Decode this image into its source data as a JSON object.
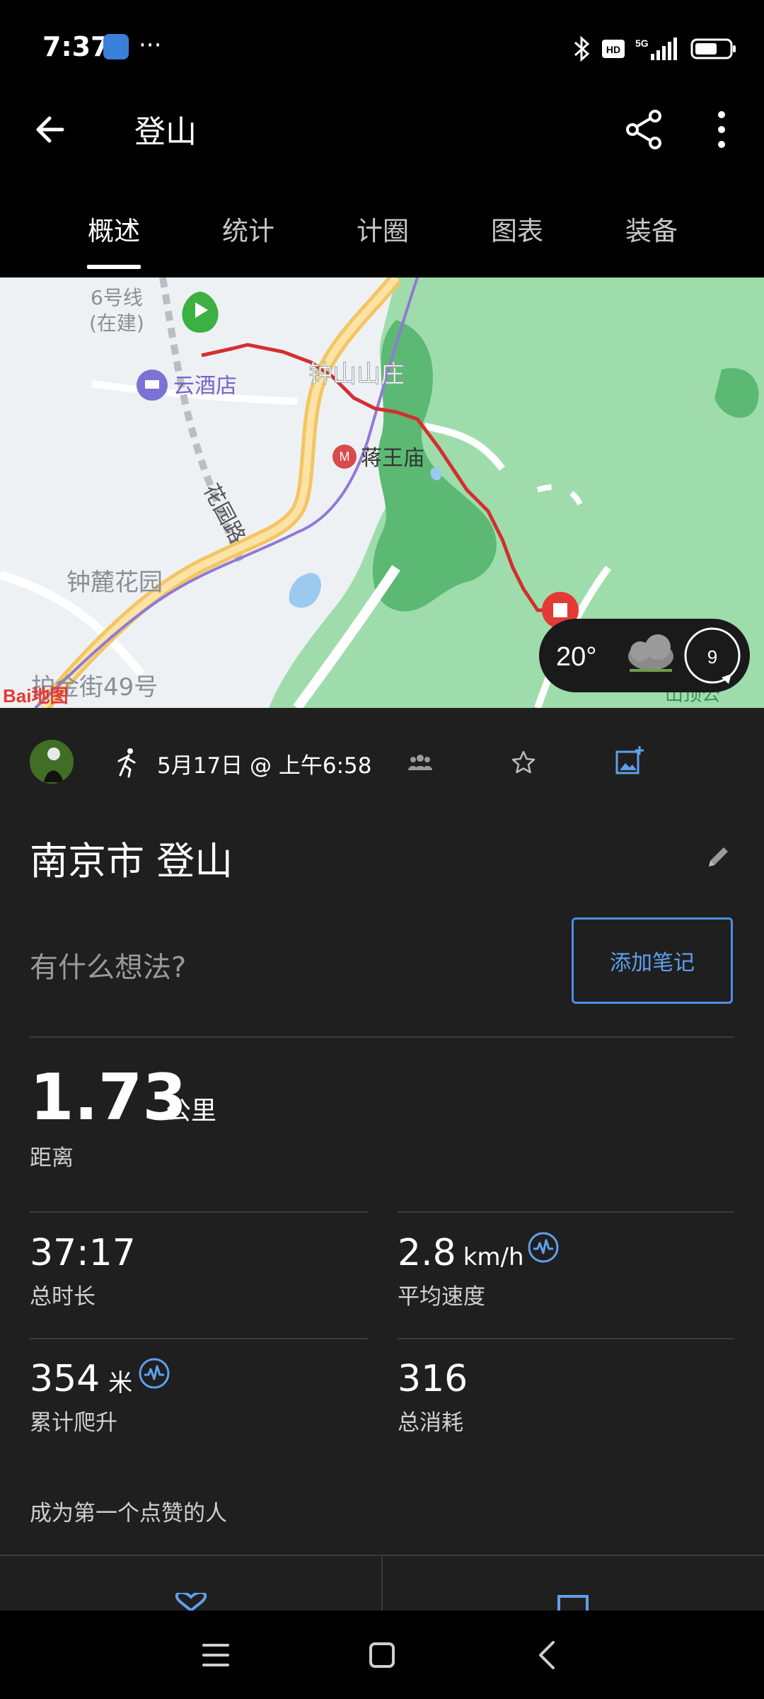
{
  "status_bar": {
    "time": "7:37",
    "more": "···",
    "hd_badge": "HD",
    "network": "5G"
  },
  "app_bar": {
    "title": "登山"
  },
  "tabs": [
    {
      "label": "概述",
      "active": true
    },
    {
      "label": "统计",
      "active": false
    },
    {
      "label": "计圈",
      "active": false
    },
    {
      "label": "图表",
      "active": false
    },
    {
      "label": "装备",
      "active": false
    }
  ],
  "map": {
    "labels": {
      "line6": "6号线",
      "under_construction": "(在建)",
      "hotel": "云酒店",
      "zhongshan": "钟山山庄",
      "jiangwang": "蒋王庙",
      "huayuan": "花园路",
      "zhonglu": "钟麓花园",
      "street": "护金街49号",
      "park": "山顶公",
      "baidu": "Bai地图"
    },
    "weather": {
      "temperature": "20°",
      "wind": "9"
    },
    "colors": {
      "route": "#d32f2f",
      "park_green": "#9fdcac",
      "forest_green": "#5cb974",
      "start_marker": "#3cb043",
      "end_marker": "#e53935"
    }
  },
  "activity": {
    "date": "5月17日 @ 上午6:58",
    "title": "南京市 登山",
    "note_placeholder": "有什么想法?",
    "add_note": "添加笔记"
  },
  "stats": {
    "distance": {
      "value": "1.73",
      "unit": "公里",
      "label": "距离"
    },
    "duration": {
      "value": "37:17",
      "label": "总时长"
    },
    "avg_speed": {
      "value": "2.8",
      "unit": "km/h",
      "label": "平均速度"
    },
    "ascent": {
      "value": "354",
      "unit": "米",
      "label": "累计爬升"
    },
    "calories": {
      "value": "316",
      "label": "总消耗"
    }
  },
  "social": {
    "like_prompt": "成为第一个点赞的人"
  },
  "theme": {
    "accent": "#4a90e2",
    "background": "#1f1f1f"
  }
}
